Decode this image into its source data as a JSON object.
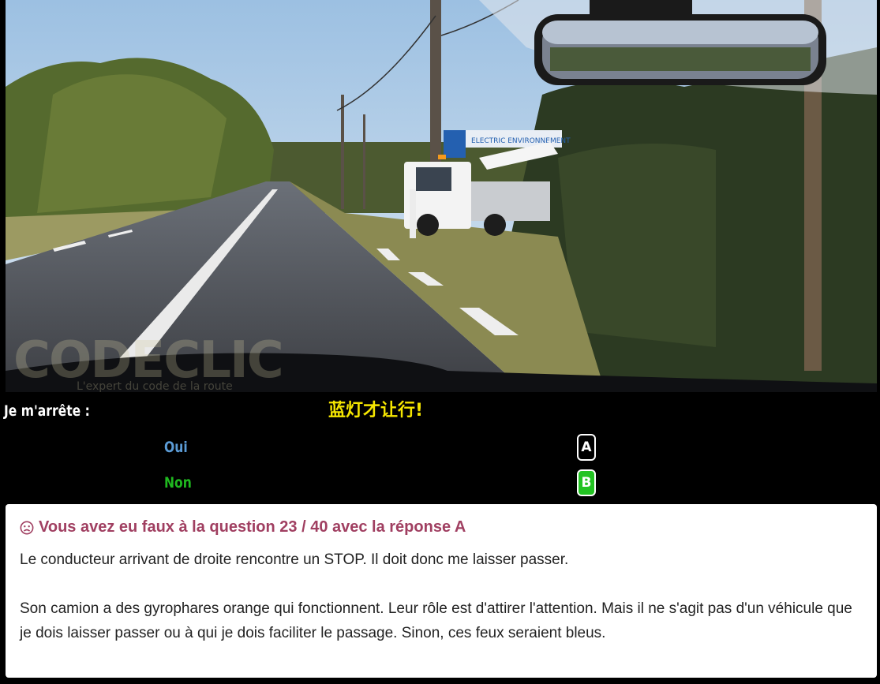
{
  "question": {
    "prompt": "Je m'arrête :",
    "hint": "蓝灯才让行!"
  },
  "answers": [
    {
      "label": "Oui",
      "key": "A",
      "color": "#5b9bd5",
      "selected": false
    },
    {
      "label": "Non",
      "key": "B",
      "color": "#1fb81f",
      "selected": true
    }
  ],
  "result": {
    "icon": "sad-face-icon",
    "title": "Vous avez eu faux à la question 23 / 40 avec la réponse A",
    "explanation": [
      "Le conducteur arrivant de droite rencontre un STOP. Il doit donc me laisser passer.",
      "Son camion a des gyrophares orange qui fonctionnent. Leur rôle est d'attirer l'attention. Mais il ne s'agit pas d'un véhicule que je dois laisser passer ou à qui je dois faciliter le passage. Sinon, ces feux seraient bleus."
    ]
  },
  "watermark": {
    "brand": "CODECLIC",
    "tagline": "L'expert du code de la route"
  },
  "truck_sign": "ELECTRIC ENVIRONNEMENT",
  "colors": {
    "result_title": "#a03f61",
    "hint": "#f5e600",
    "correct": "#22c322"
  }
}
